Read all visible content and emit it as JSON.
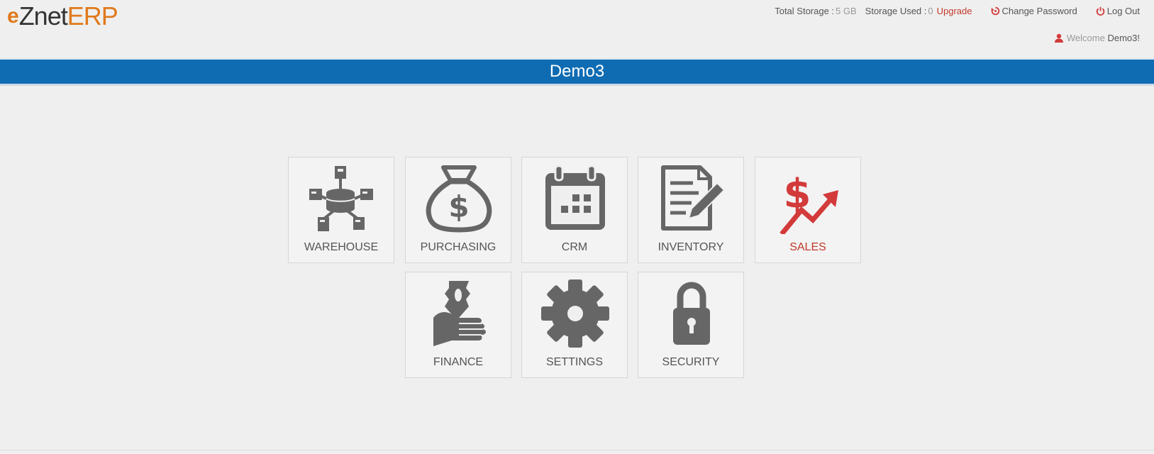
{
  "brand": {
    "prefix": "e",
    "name": "Znet",
    "suffix": "ERP"
  },
  "header": {
    "total_storage_label": "Total Storage :",
    "total_storage_value": "5 GB",
    "storage_used_label": "Storage Used :",
    "storage_used_value": "0",
    "upgrade_label": "Upgrade",
    "change_password_label": "Change Password",
    "logout_label": "Log Out",
    "welcome_prefix": "Welcome",
    "welcome_user": "Demo3!"
  },
  "banner": {
    "title": "Demo3"
  },
  "modules": [
    {
      "label": "WAREHOUSE",
      "icon": "warehouse-network-icon"
    },
    {
      "label": "PURCHASING",
      "icon": "money-bag-icon"
    },
    {
      "label": "CRM",
      "icon": "calendar-icon"
    },
    {
      "label": "INVENTORY",
      "icon": "document-pencil-icon"
    },
    {
      "label": "SALES",
      "icon": "dollar-trend-up-icon"
    },
    {
      "label": "FINANCE",
      "icon": "hand-money-icon"
    },
    {
      "label": "SETTINGS",
      "icon": "gear-icon"
    },
    {
      "label": "SECURITY",
      "icon": "padlock-icon"
    }
  ],
  "colors": {
    "banner": "#0f6cb3",
    "accent": "#e07a1c",
    "sales": "#d33a3a",
    "icon": "#666666"
  }
}
